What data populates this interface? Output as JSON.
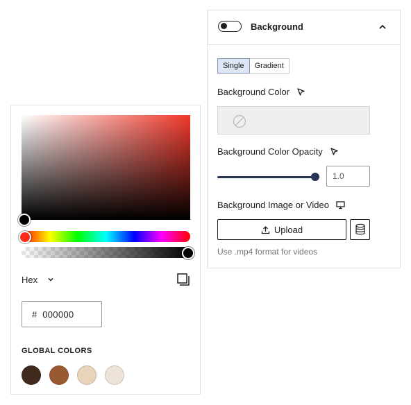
{
  "color_picker": {
    "current_hue_color": "#f0382b",
    "format_label": "Hex",
    "hex_prefix": "#",
    "hex_value": "000000",
    "global_colors_title": "GLOBAL COLORS",
    "global_colors": [
      "#3f2a1d",
      "#9a5a31",
      "#e8d3bb",
      "#ede3d8"
    ],
    "alpha_level": 1.0,
    "hue_level": 0.0
  },
  "background_panel": {
    "title": "Background",
    "toggle_on": false,
    "type_tabs": [
      "Single",
      "Gradient"
    ],
    "active_tab": "Single",
    "color_label": "Background Color",
    "opacity_label": "Background Color Opacity",
    "opacity_value": "1.0",
    "opacity_level": 1.0,
    "image_label": "Background Image or Video",
    "upload_label": "Upload",
    "help_text": "Use .mp4 format for videos",
    "icons": {
      "color": "cursor-arrow-icon",
      "opacity": "cursor-arrow-icon",
      "image": "desktop-icon",
      "upload": "upload-icon",
      "library": "database-icon",
      "collapse": "chevron-up-icon"
    }
  }
}
